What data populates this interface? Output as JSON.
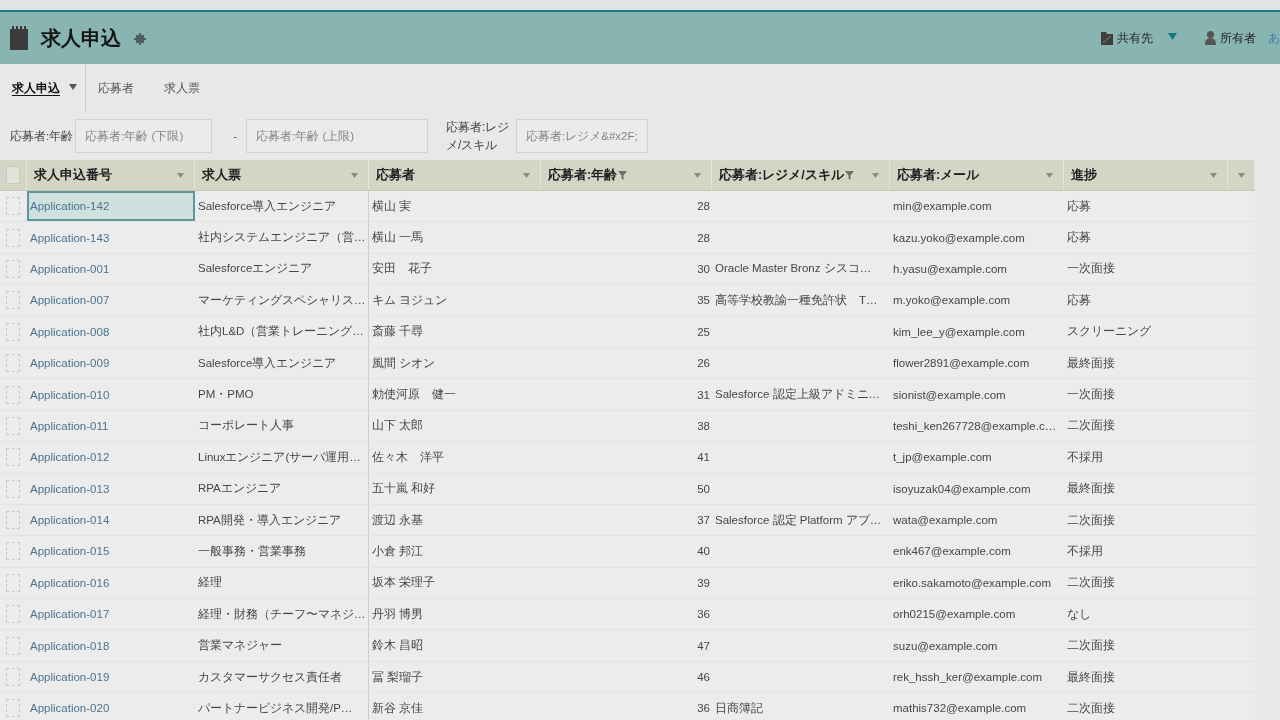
{
  "header": {
    "title": "求人申込",
    "share": {
      "label": "共有先"
    },
    "owner": {
      "label": "所有者",
      "name": "あ"
    }
  },
  "tabs": [
    {
      "label": "求人申込",
      "selected": true,
      "has_menu": true
    },
    {
      "label": "応募者",
      "selected": false,
      "has_menu": false
    },
    {
      "label": "求人票",
      "selected": false,
      "has_menu": false
    }
  ],
  "filters": [
    {
      "kind": "range",
      "label": "応募者:年齢",
      "fields": [
        {
          "placeholder": "応募者:年齢 (下限)"
        },
        {
          "placeholder": "応募者:年齢 (上限)"
        }
      ],
      "separator": "-"
    },
    {
      "kind": "text",
      "label": "応募者:レジメ/スキル",
      "fields": [
        {
          "placeholder": "応募者:レジメ&#x2F;"
        }
      ]
    }
  ],
  "table": {
    "select_all_checked": false,
    "columns": [
      {
        "label": "求人申込番号",
        "kind": "link",
        "filtered": false
      },
      {
        "label": "求人票",
        "kind": "text",
        "filtered": false
      },
      {
        "label": "応募者",
        "kind": "text",
        "filtered": false
      },
      {
        "label": "応募者:年齢",
        "kind": "number",
        "filtered": true
      },
      {
        "label": "応募者:レジメ/スキル",
        "kind": "text",
        "filtered": true
      },
      {
        "label": "応募者:メール",
        "kind": "text",
        "filtered": false
      },
      {
        "label": "進捗",
        "kind": "text",
        "filtered": false
      }
    ],
    "rows": [
      {
        "selected": true,
        "checked": false,
        "application_no": "Application-142",
        "job_posting": "Salesforce導入エンジニア",
        "applicant": "横山 実",
        "age": "28",
        "email": "min@example.com",
        "progress": "応募"
      },
      {
        "selected": false,
        "checked": false,
        "application_no": "Application-143",
        "job_posting": "社内システムエンジニア（営…",
        "applicant": "横山 一馬",
        "age": "28",
        "email": "kazu.yoko@example.com",
        "progress": "応募"
      },
      {
        "selected": false,
        "checked": false,
        "application_no": "Application-001",
        "job_posting": "Salesforceエンジニア",
        "applicant": "安田　花子",
        "age": "30",
        "resume_skill": "Oracle Master Bronz シスコ…",
        "email": "h.yasu@example.com",
        "progress": "一次面接"
      },
      {
        "selected": false,
        "checked": false,
        "application_no": "Application-007",
        "job_posting": "マーケティングスペシャリス…",
        "applicant": "キム ヨジュン",
        "age": "35",
        "resume_skill": "高等学校教諭一種免許状　T…",
        "email": "m.yoko@example.com",
        "progress": "応募"
      },
      {
        "selected": false,
        "checked": false,
        "application_no": "Application-008",
        "job_posting": "社内L&D（営業トレーニング…",
        "applicant": "斎藤 千尋",
        "age": "25",
        "email": "kim_lee_y@example.com",
        "progress": "スクリーニング"
      },
      {
        "selected": false,
        "checked": false,
        "application_no": "Application-009",
        "job_posting": "Salesforce導入エンジニア",
        "applicant": "風間 シオン",
        "age": "26",
        "email": "flower2891@example.com",
        "progress": "最終面接"
      },
      {
        "selected": false,
        "checked": false,
        "application_no": "Application-010",
        "job_posting": "PM・PMO",
        "applicant": "勅使河原　健一",
        "age": "31",
        "resume_skill": "Salesforce 認定上級アドミニ…",
        "email": "sionist@example.com",
        "progress": "一次面接"
      },
      {
        "selected": false,
        "checked": false,
        "application_no": "Application-011",
        "job_posting": "コーポレート人事",
        "applicant": "山下 太郎",
        "age": "38",
        "email": "teshi_ken267728@example.c…",
        "progress": "二次面接"
      },
      {
        "selected": false,
        "checked": false,
        "application_no": "Application-012",
        "job_posting": "Linuxエンジニア(サーバ運用…",
        "applicant": "佐々木　洋平",
        "age": "41",
        "email": "t_jp@example.com",
        "progress": "不採用"
      },
      {
        "selected": false,
        "checked": false,
        "application_no": "Application-013",
        "job_posting": "RPAエンジニア",
        "applicant": "五十嵐 和好",
        "age": "50",
        "email": "isoyuzak04@example.com",
        "progress": "最終面接"
      },
      {
        "selected": false,
        "checked": false,
        "application_no": "Application-014",
        "job_posting": "RPA開発・導入エンジニア",
        "applicant": "渡辺 永基",
        "age": "37",
        "resume_skill": "Salesforce 認定 Platform アプ…",
        "email": "wata@example.com",
        "progress": "二次面接"
      },
      {
        "selected": false,
        "checked": false,
        "application_no": "Application-015",
        "job_posting": "一般事務・営業事務",
        "applicant": "小倉 邦江",
        "age": "40",
        "email": "enk467@example.com",
        "progress": "不採用"
      },
      {
        "selected": false,
        "checked": false,
        "application_no": "Application-016",
        "job_posting": "経理",
        "applicant": "坂本 栄理子",
        "age": "39",
        "email": "eriko.sakamoto@example.com",
        "progress": "二次面接"
      },
      {
        "selected": false,
        "checked": false,
        "application_no": "Application-017",
        "job_posting": "経理・財務（チーフ〜マネジ…",
        "applicant": "丹羽 博男",
        "age": "36",
        "email": "orh0215@example.com",
        "progress": "なし"
      },
      {
        "selected": false,
        "checked": false,
        "application_no": "Application-018",
        "job_posting": "営業マネジャー",
        "applicant": "鈴木 昌昭",
        "age": "47",
        "email": "suzu@example.com",
        "progress": "二次面接"
      },
      {
        "selected": false,
        "checked": false,
        "application_no": "Application-019",
        "job_posting": "カスタマーサクセス責任者",
        "applicant": "冨 梨瑠子",
        "age": "46",
        "email": "rek_hssh_ker@example.com",
        "progress": "最終面接"
      },
      {
        "selected": false,
        "checked": false,
        "application_no": "Application-020",
        "job_posting": "パートナービジネス開発/P…",
        "applicant": "新谷 京佳",
        "age": "36",
        "resume_skill": "日商簿記",
        "email": "mathis732@example.com",
        "progress": "二次面接"
      }
    ]
  }
}
